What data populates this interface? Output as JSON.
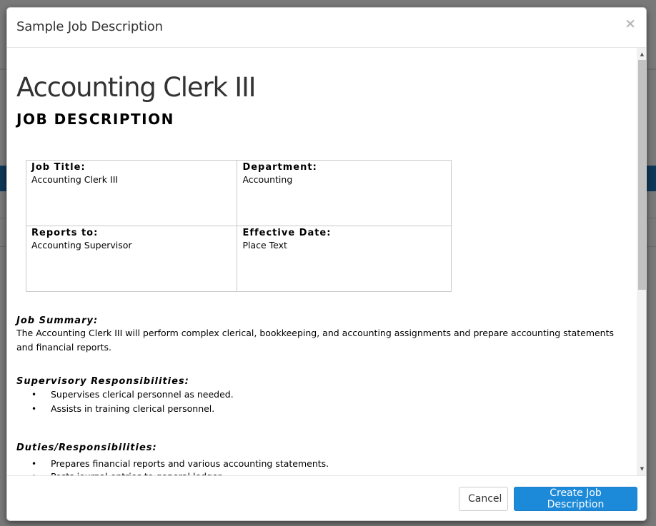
{
  "modal": {
    "title": "Sample Job Description",
    "close_symbol": "×"
  },
  "document": {
    "title": "Accounting Clerk III",
    "subtitle": "JOB DESCRIPTION",
    "info_table": {
      "job_title_label": "Job Title:",
      "job_title_value": "Accounting Clerk III",
      "department_label": "Department:",
      "department_value": "Accounting",
      "reports_to_label": "Reports to:",
      "reports_to_value": "Accounting Supervisor",
      "effective_date_label": "Effective Date:",
      "effective_date_value": "Place Text"
    },
    "job_summary": {
      "heading": "Job Summary:",
      "text": "The Accounting Clerk III will perform complex clerical, bookkeeping, and accounting assignments and prepare accounting statements and financial reports."
    },
    "supervisory": {
      "heading": "Supervisory Responsibilities:",
      "items": [
        "Supervises clerical personnel as needed.",
        "Assists in training clerical personnel."
      ]
    },
    "duties": {
      "heading": "Duties/Responsibilities:",
      "items": [
        "Prepares financial reports and various accounting statements.",
        "Posts journal entries to general ledger."
      ]
    }
  },
  "scrollbar": {
    "up_icon": "▲",
    "down_icon": "▼"
  },
  "footer": {
    "cancel_label": "Cancel",
    "create_label": "Create Job Description"
  },
  "colors": {
    "primary": "#1c8ad9"
  }
}
